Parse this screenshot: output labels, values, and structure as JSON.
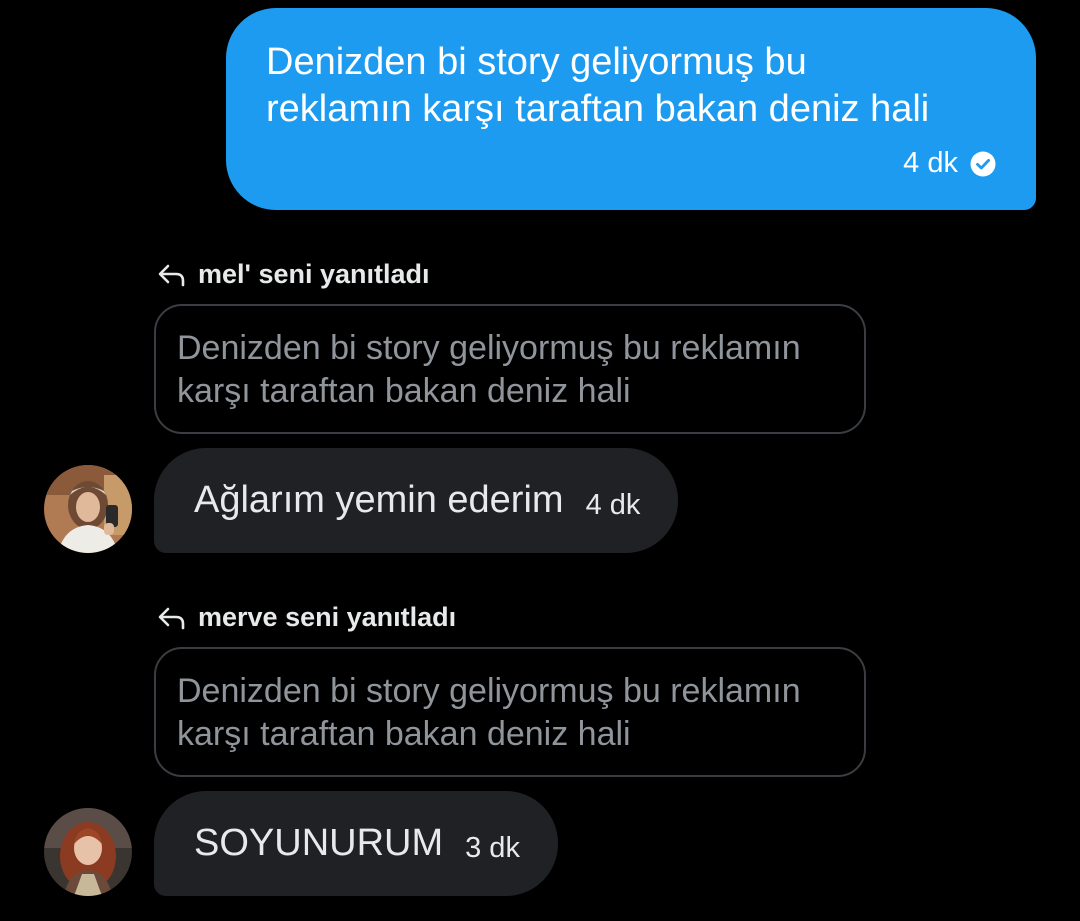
{
  "outgoing": {
    "text": "Denizden bi story geliyormuş bu reklamın karşı taraftan bakan deniz hali",
    "time": "4 dk",
    "status_icon": "read-check-icon",
    "bubble_color": "#1d9bf0"
  },
  "replies": [
    {
      "header": "mel' seni yanıtladı",
      "quote": "Denizden bi story geliyormuş bu reklamın karşı taraftan bakan deniz hali",
      "message": "Ağlarım yemin ederim",
      "time": "4 dk"
    },
    {
      "header": "merve seni yanıtladı",
      "quote": "Denizden bi story geliyormuş bu reklamın karşı taraftan bakan deniz hali",
      "message": "SOYUNURUM",
      "time": "3 dk"
    }
  ],
  "colors": {
    "background": "#000000",
    "incoming_bubble": "#1f2125",
    "quote_border": "#3a3d42",
    "quote_text": "#8f959b"
  }
}
